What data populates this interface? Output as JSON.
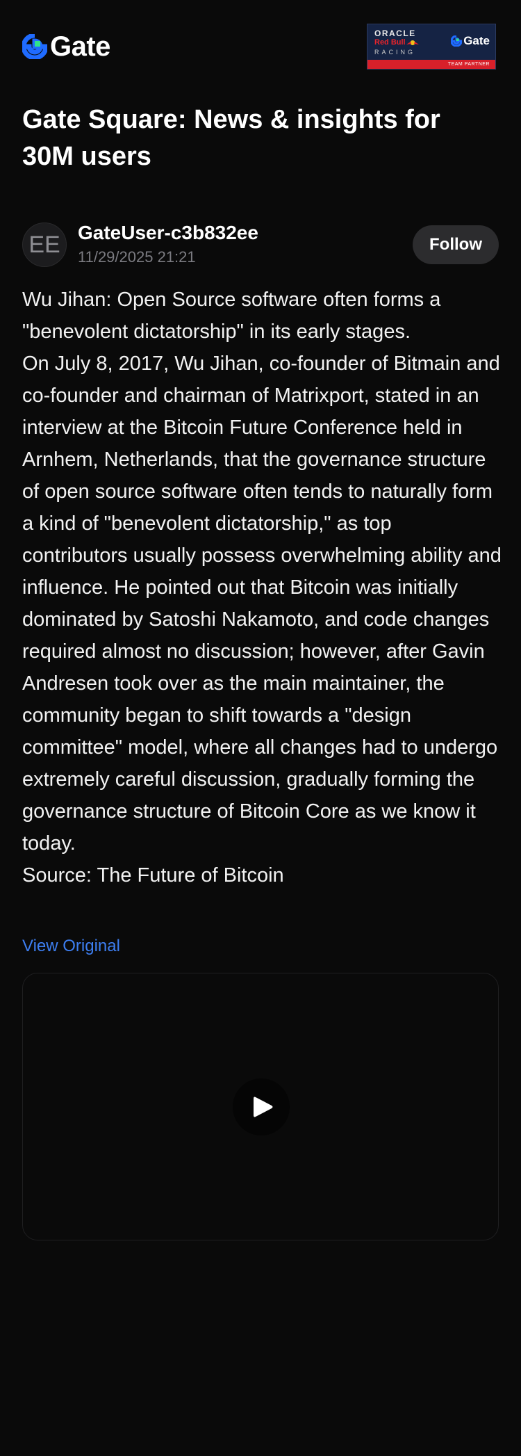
{
  "header": {
    "brand_name": "Gate",
    "logo_icon": "gate-logo-icon",
    "partner_badge": {
      "oracle": "ORACLE",
      "red_bull": "Red Bull",
      "racing": "RACING",
      "gate": "Gate",
      "team_partner": "TEAM PARTNER"
    }
  },
  "page": {
    "title": "Gate Square: News & insights for 30M users"
  },
  "author": {
    "avatar_initials": "EE",
    "name": "GateUser-c3b832ee",
    "timestamp": "11/29/2025 21:21",
    "follow_label": "Follow"
  },
  "post": {
    "paragraphs": [
      "Wu Jihan: Open Source software often forms a \"benevolent dictatorship\" in its early stages.",
      "On July 8, 2017, Wu Jihan, co-founder of Bitmain and co-founder and chairman of Matrixport, stated in an interview at the Bitcoin Future Conference held in Arnhem, Netherlands, that the governance structure of open source software often tends to naturally form a kind of \"benevolent dictatorship,\" as top contributors usually possess overwhelming ability and influence. He pointed out that Bitcoin was initially dominated by Satoshi Nakamoto, and code changes required almost no discussion; however, after Gavin Andresen took over as the main maintainer, the community began to shift towards a \"design committee\" model, where all changes had to undergo extremely careful discussion, gradually forming the governance structure of Bitcoin Core as we know it today.",
      "Source: The Future of Bitcoin"
    ],
    "view_original_label": "View Original"
  },
  "video": {
    "play_icon": "play-icon"
  },
  "colors": {
    "background": "#0a0a0a",
    "link": "#3d7ef0",
    "brand_blue": "#1f6bff",
    "brand_green": "#2fe38a",
    "follow_bg": "#2c2c2e",
    "muted": "#7c7c82"
  }
}
